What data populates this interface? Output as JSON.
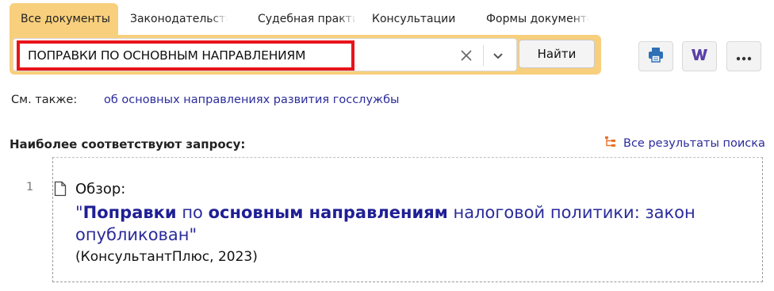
{
  "tabs": [
    {
      "label": "Все документы",
      "active": true
    },
    {
      "label": "Законодательство"
    },
    {
      "label": "Судебная практика"
    },
    {
      "label": "Консультации"
    },
    {
      "label": "Формы документов"
    }
  ],
  "search": {
    "value": "ПОПРАВКИ ПО ОСНОВНЫМ НАПРАВЛЕНИЯМ",
    "button_label": "Найти"
  },
  "toolbar": {
    "icons": [
      "printer-icon",
      "word-icon",
      "more-icon"
    ]
  },
  "see_also": {
    "label": "См. также:",
    "link": "об основных направлениях развития госслужбы"
  },
  "results": {
    "section_title": "Наиболее соответствуют запросу:",
    "all_results_label": "Все результаты поиска",
    "items": [
      {
        "number": "1",
        "type": "Обзор:",
        "title_parts": [
          "\"",
          "Поправки",
          " по ",
          "основным направлениям",
          " налоговой политики: закон опубликован\""
        ],
        "source": "(КонсультантПлюс, 2023)"
      }
    ]
  },
  "colors": {
    "accent": "#f8cf7c",
    "highlight": "#e8141b",
    "link": "#2b2b9c",
    "word_icon": "#5b3fa8",
    "tree_icon": "#e8732a"
  }
}
